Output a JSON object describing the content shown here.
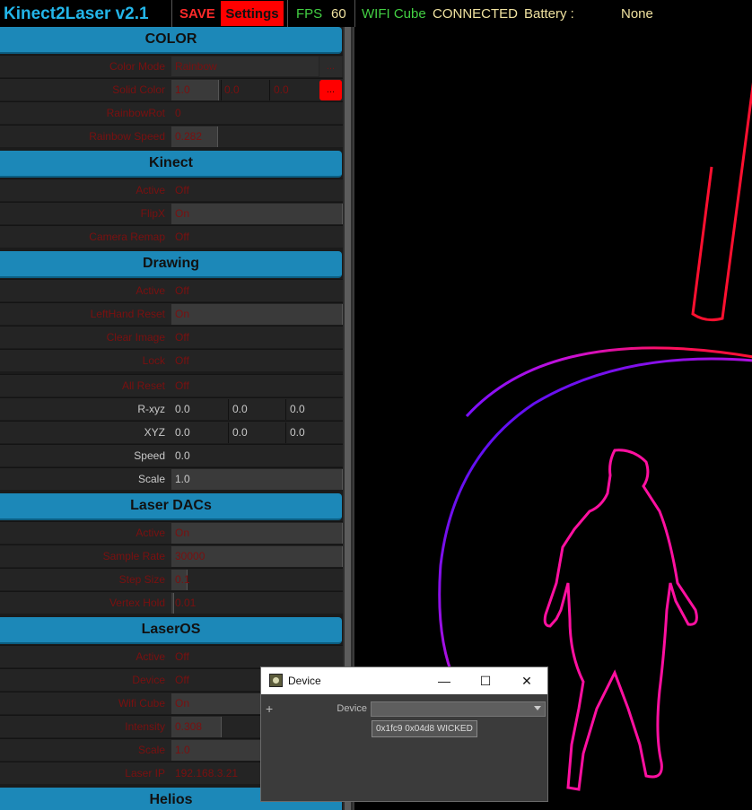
{
  "topbar": {
    "title": "Kinect2Laser v2.1",
    "save": "SAVE",
    "settings": "Settings",
    "fps_label": "FPS",
    "fps_value": "60",
    "wifi_label": "WIFI Cube",
    "wifi_status": "CONNECTED",
    "battery_label": "Battery :",
    "battery_value": "None"
  },
  "sections": {
    "color": {
      "title": "COLOR",
      "color_mode": {
        "label": "Color Mode",
        "value": "Rainbow",
        "btn": "..."
      },
      "solid_color": {
        "label": "Solid Color",
        "v1": "1.0",
        "v2": "0.0",
        "v3": "0.0",
        "btn": "..."
      },
      "rainbow_rot": {
        "label": "RainbowRot",
        "value": "0"
      },
      "rainbow_speed": {
        "label": "Rainbow Speed",
        "value": "0.282"
      }
    },
    "kinect": {
      "title": "Kinect",
      "active": {
        "label": "Active",
        "value": "Off"
      },
      "flipx": {
        "label": "FlipX",
        "value": "On"
      },
      "camera_remap": {
        "label": "Camera Remap",
        "value": "Off"
      }
    },
    "drawing": {
      "title": "Drawing",
      "active": {
        "label": "Active",
        "value": "Off"
      },
      "lefthand_reset": {
        "label": "LeftHand Reset",
        "value": "On"
      },
      "clear_image": {
        "label": "Clear Image",
        "value": "Off"
      },
      "lock": {
        "label": "Lock",
        "value": "Off"
      },
      "all_reset": {
        "label": "All Reset",
        "value": "Off"
      },
      "rxyz": {
        "label": "R-xyz",
        "v1": "0.0",
        "v2": "0.0",
        "v3": "0.0"
      },
      "xyz": {
        "label": "XYZ",
        "v1": "0.0",
        "v2": "0.0",
        "v3": "0.0"
      },
      "speed": {
        "label": "Speed",
        "value": "0.0"
      },
      "scale": {
        "label": "Scale",
        "value": "1.0"
      }
    },
    "laser_dacs": {
      "title": "Laser DACs",
      "active": {
        "label": "Active",
        "value": "On"
      },
      "sample_rate": {
        "label": "Sample Rate",
        "value": "30000"
      },
      "step_size": {
        "label": "Step Size",
        "value": "0.1"
      },
      "vertex_hold": {
        "label": "Vertex Hold",
        "value": "0.01"
      }
    },
    "laseros": {
      "title": "LaserOS",
      "active": {
        "label": "Active",
        "value": "Off"
      },
      "device": {
        "label": "Device",
        "value": "Off"
      },
      "wifi_cube": {
        "label": "Wifi Cube",
        "value": "On"
      },
      "intensity": {
        "label": "Intensity",
        "value": "0.308"
      },
      "scale": {
        "label": "Scale",
        "value": "1.0"
      },
      "laser_ip": {
        "label": "Laser IP",
        "value": "192.168.3.21"
      }
    },
    "helios": {
      "title": "Helios"
    }
  },
  "device_dialog": {
    "title": "Device",
    "minimize": "—",
    "maximize": "☐",
    "close": "✕",
    "add": "+",
    "device_label": "Device",
    "option": "0x1fc9 0x04d8 WICKED"
  },
  "colors": {
    "accent": "#1c88b8",
    "alert": "#ff0000",
    "fps": "#43d043"
  }
}
